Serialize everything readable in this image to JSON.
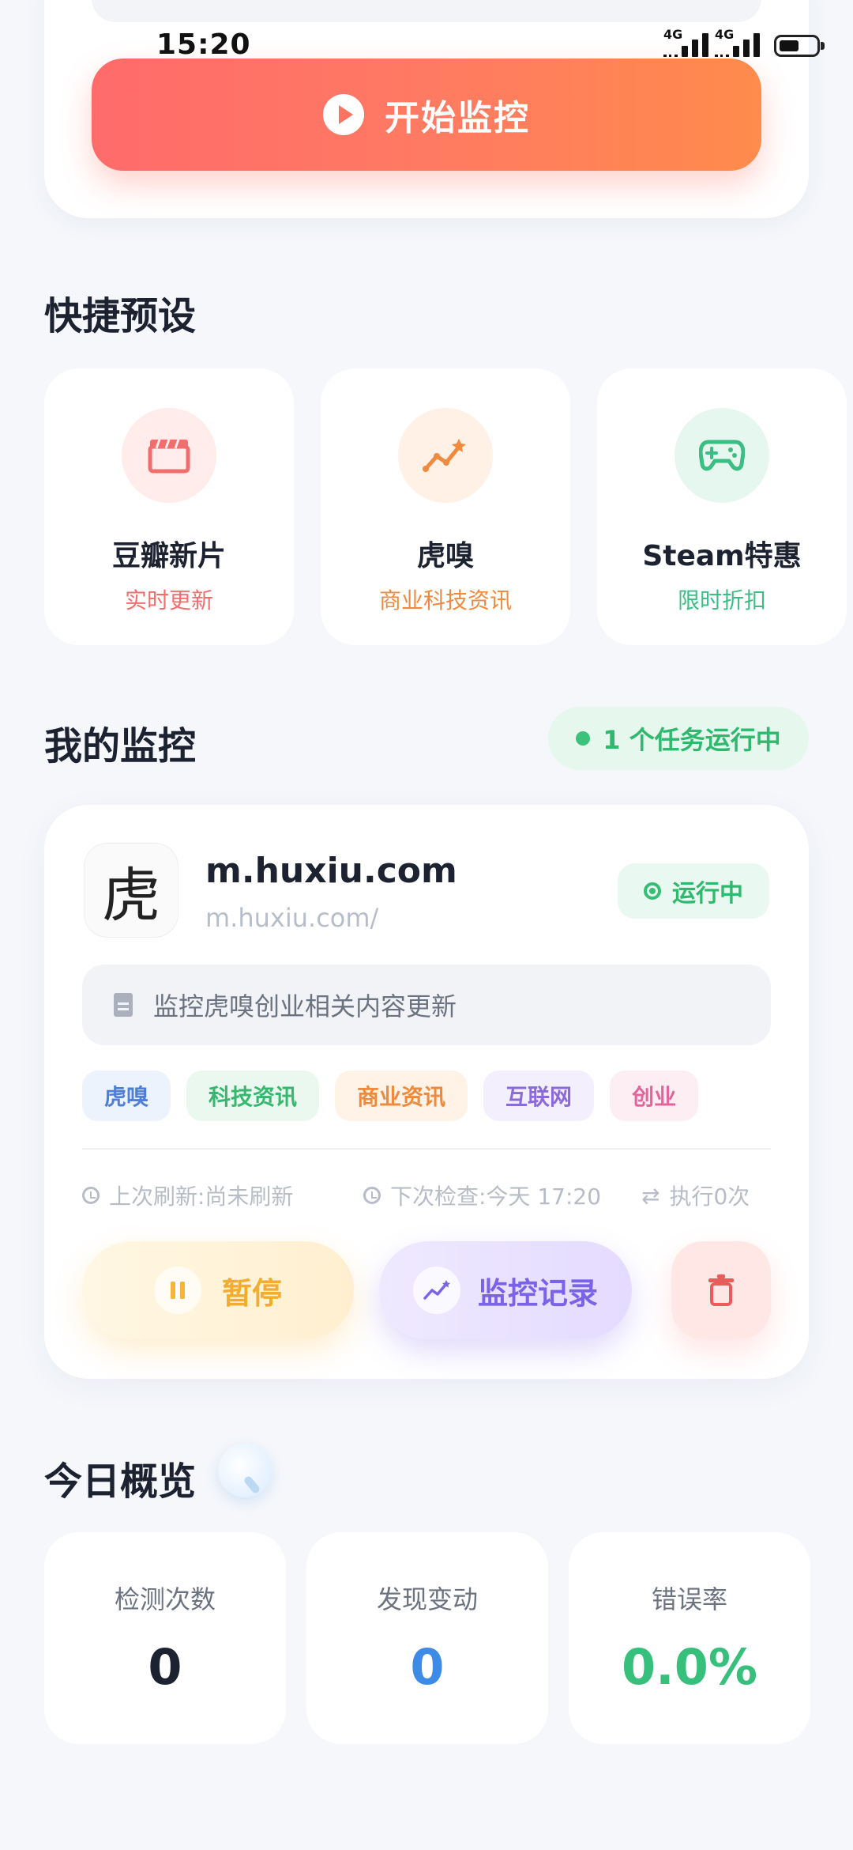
{
  "status_bar": {
    "time": "15:20",
    "network1": "4G",
    "network2": "4G"
  },
  "top": {
    "start_button_label": "开始监控"
  },
  "presets": {
    "title": "快捷预设",
    "items": [
      {
        "name": "豆瓣新片",
        "sub": "实时更新",
        "icon": "clapperboard-icon",
        "color": "#f06e6e",
        "bg": "#ffeceb"
      },
      {
        "name": "虎嗅",
        "sub": "商业科技资讯",
        "icon": "trend-chart-icon",
        "color": "#f08a3e",
        "bg": "#fff1e6"
      },
      {
        "name": "Steam特惠",
        "sub": "限时折扣",
        "icon": "gamepad-icon",
        "color": "#3bbd84",
        "bg": "#e6f7ef"
      }
    ]
  },
  "my_monitors": {
    "title": "我的监控",
    "running_badge": "1 个任务运行中"
  },
  "monitor": {
    "logo_char": "虎",
    "site_name": "m.huxiu.com",
    "site_url": "m.huxiu.com/",
    "status": "运行中",
    "description": "监控虎嗅创业相关内容更新",
    "tags": [
      {
        "label": "虎嗅",
        "color": "#4e7fd6",
        "bg": "#edf3fd"
      },
      {
        "label": "科技资讯",
        "color": "#36b86f",
        "bg": "#eaf8f0"
      },
      {
        "label": "商业资讯",
        "color": "#ee8a3c",
        "bg": "#fff2e6"
      },
      {
        "label": "互联网",
        "color": "#8a6bd8",
        "bg": "#f3effd"
      },
      {
        "label": "创业",
        "color": "#e4649a",
        "bg": "#fdeef4"
      }
    ],
    "last_refresh": "上次刷新:尚未刷新",
    "next_check": "下次检查:今天 17:20",
    "exec_count": "执行0次",
    "pause_label": "暂停",
    "log_label": "监控记录"
  },
  "overview": {
    "title": "今日概览",
    "stats": [
      {
        "label": "检测次数",
        "value": "0",
        "color": "#1c2230"
      },
      {
        "label": "发现变动",
        "value": "0",
        "color": "#3d8be6"
      },
      {
        "label": "错误率",
        "value": "0.0%",
        "color": "#37c07c"
      }
    ]
  }
}
